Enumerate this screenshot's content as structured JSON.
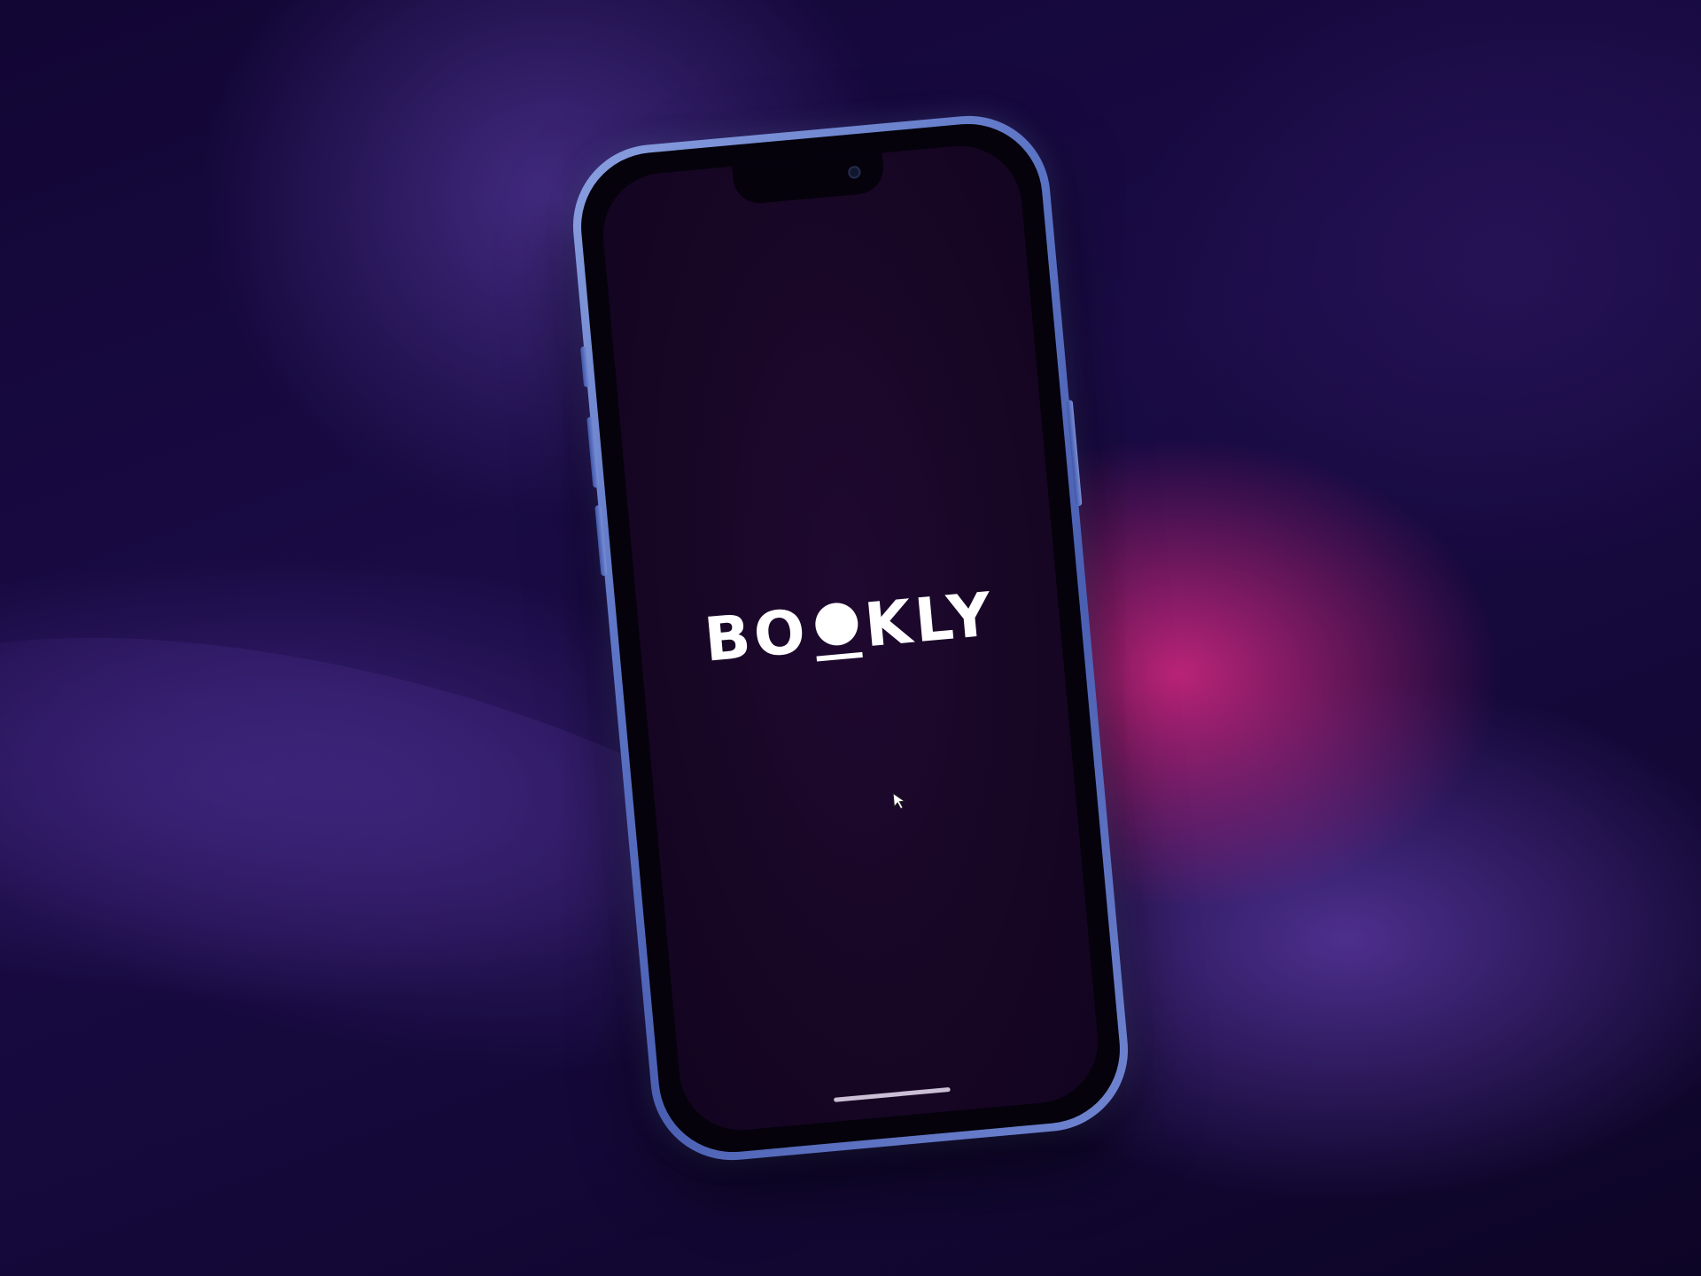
{
  "app": {
    "name": "BOOKLY",
    "logo_parts": [
      "B",
      "O",
      "KLY"
    ]
  },
  "theme": {
    "background": "#140838",
    "accent_pink": "#d62882",
    "accent_violet": "#603caa",
    "phone_frame": "#5b73c4",
    "screen_bg": "#170624",
    "logo_color": "#ffffff"
  },
  "icons": {
    "cursor": "cursor-arrow-icon",
    "front_camera": "front-camera-icon"
  }
}
